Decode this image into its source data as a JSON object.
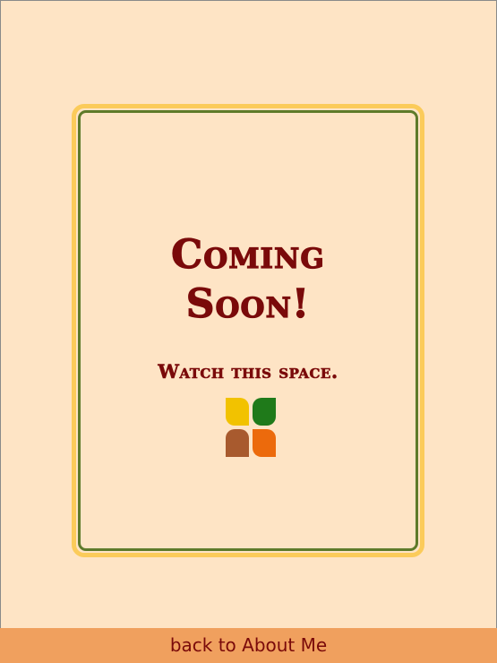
{
  "main": {
    "title_line1": "Coming",
    "title_line2": "Soon!",
    "subtitle": "Watch this space."
  },
  "logo": {
    "icon": "four-leaf-logo-icon",
    "colors": [
      "#f2c200",
      "#1f7a1a",
      "#a85a2e",
      "#ec6a0c"
    ]
  },
  "footer": {
    "link_label": "back to About Me",
    "bar_color": "#f0a05e"
  },
  "colors": {
    "background": "#fee4c5",
    "title": "#7a0a0a",
    "frame_outer": "#fbcb5a",
    "frame_inner": "#5e7a2a"
  }
}
